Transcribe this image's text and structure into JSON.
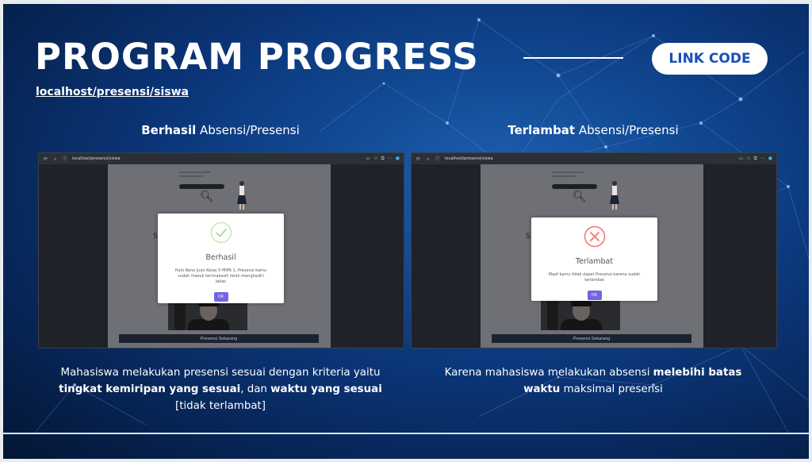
{
  "header": {
    "title": "PROGRAM PROGRESS",
    "link_button": "LINK CODE",
    "url": "localhost/presensi/siswa"
  },
  "columns": [
    {
      "heading_bold": "Berhasil",
      "heading_rest": " Absensi/Presensi",
      "browser_address": "localhost/presensi/siswa",
      "modal_title": "Berhasil",
      "modal_text": "Halo Reno Juan Kelas X MIPA 1, Presensi kamu sudah masuk terimakasih telah menghadiri kelas",
      "modal_button": "OK",
      "modal_icon": "check-circle-icon",
      "modal_icon_color": "#a5dc86",
      "presensi_button": "Presensi Sekarang",
      "caption_parts": {
        "p1": "Mahasiswa melakukan presensi sesuai dengan kriteria yaitu ",
        "b1": "tingkat kemiripan yang sesuai",
        "p2": ", dan ",
        "b2": "waktu yang sesuai",
        "p3": " [tidak terlambat]"
      }
    },
    {
      "heading_bold": "Terlambat",
      "heading_rest": " Absensi/Presensi",
      "browser_address": "localhost/presensi/siswa",
      "modal_title": "Terlambat",
      "modal_text": "Maaf kamu tidak dapat Presensi karena sudah terlambat",
      "modal_button": "OK",
      "modal_icon": "x-circle-icon",
      "modal_icon_color": "#f27474",
      "presensi_button": "Presensi Sekarang",
      "caption_parts": {
        "p1": "Karena mahasiswa melakukan absensi ",
        "b1": "melebihi batas waktu",
        "p2": " maksimal presensi"
      }
    }
  ],
  "colors": {
    "background_dark": "#041634",
    "background_mid": "#124a94",
    "accent_link": "#1a4fb8",
    "ok_button": "#7066e0"
  }
}
